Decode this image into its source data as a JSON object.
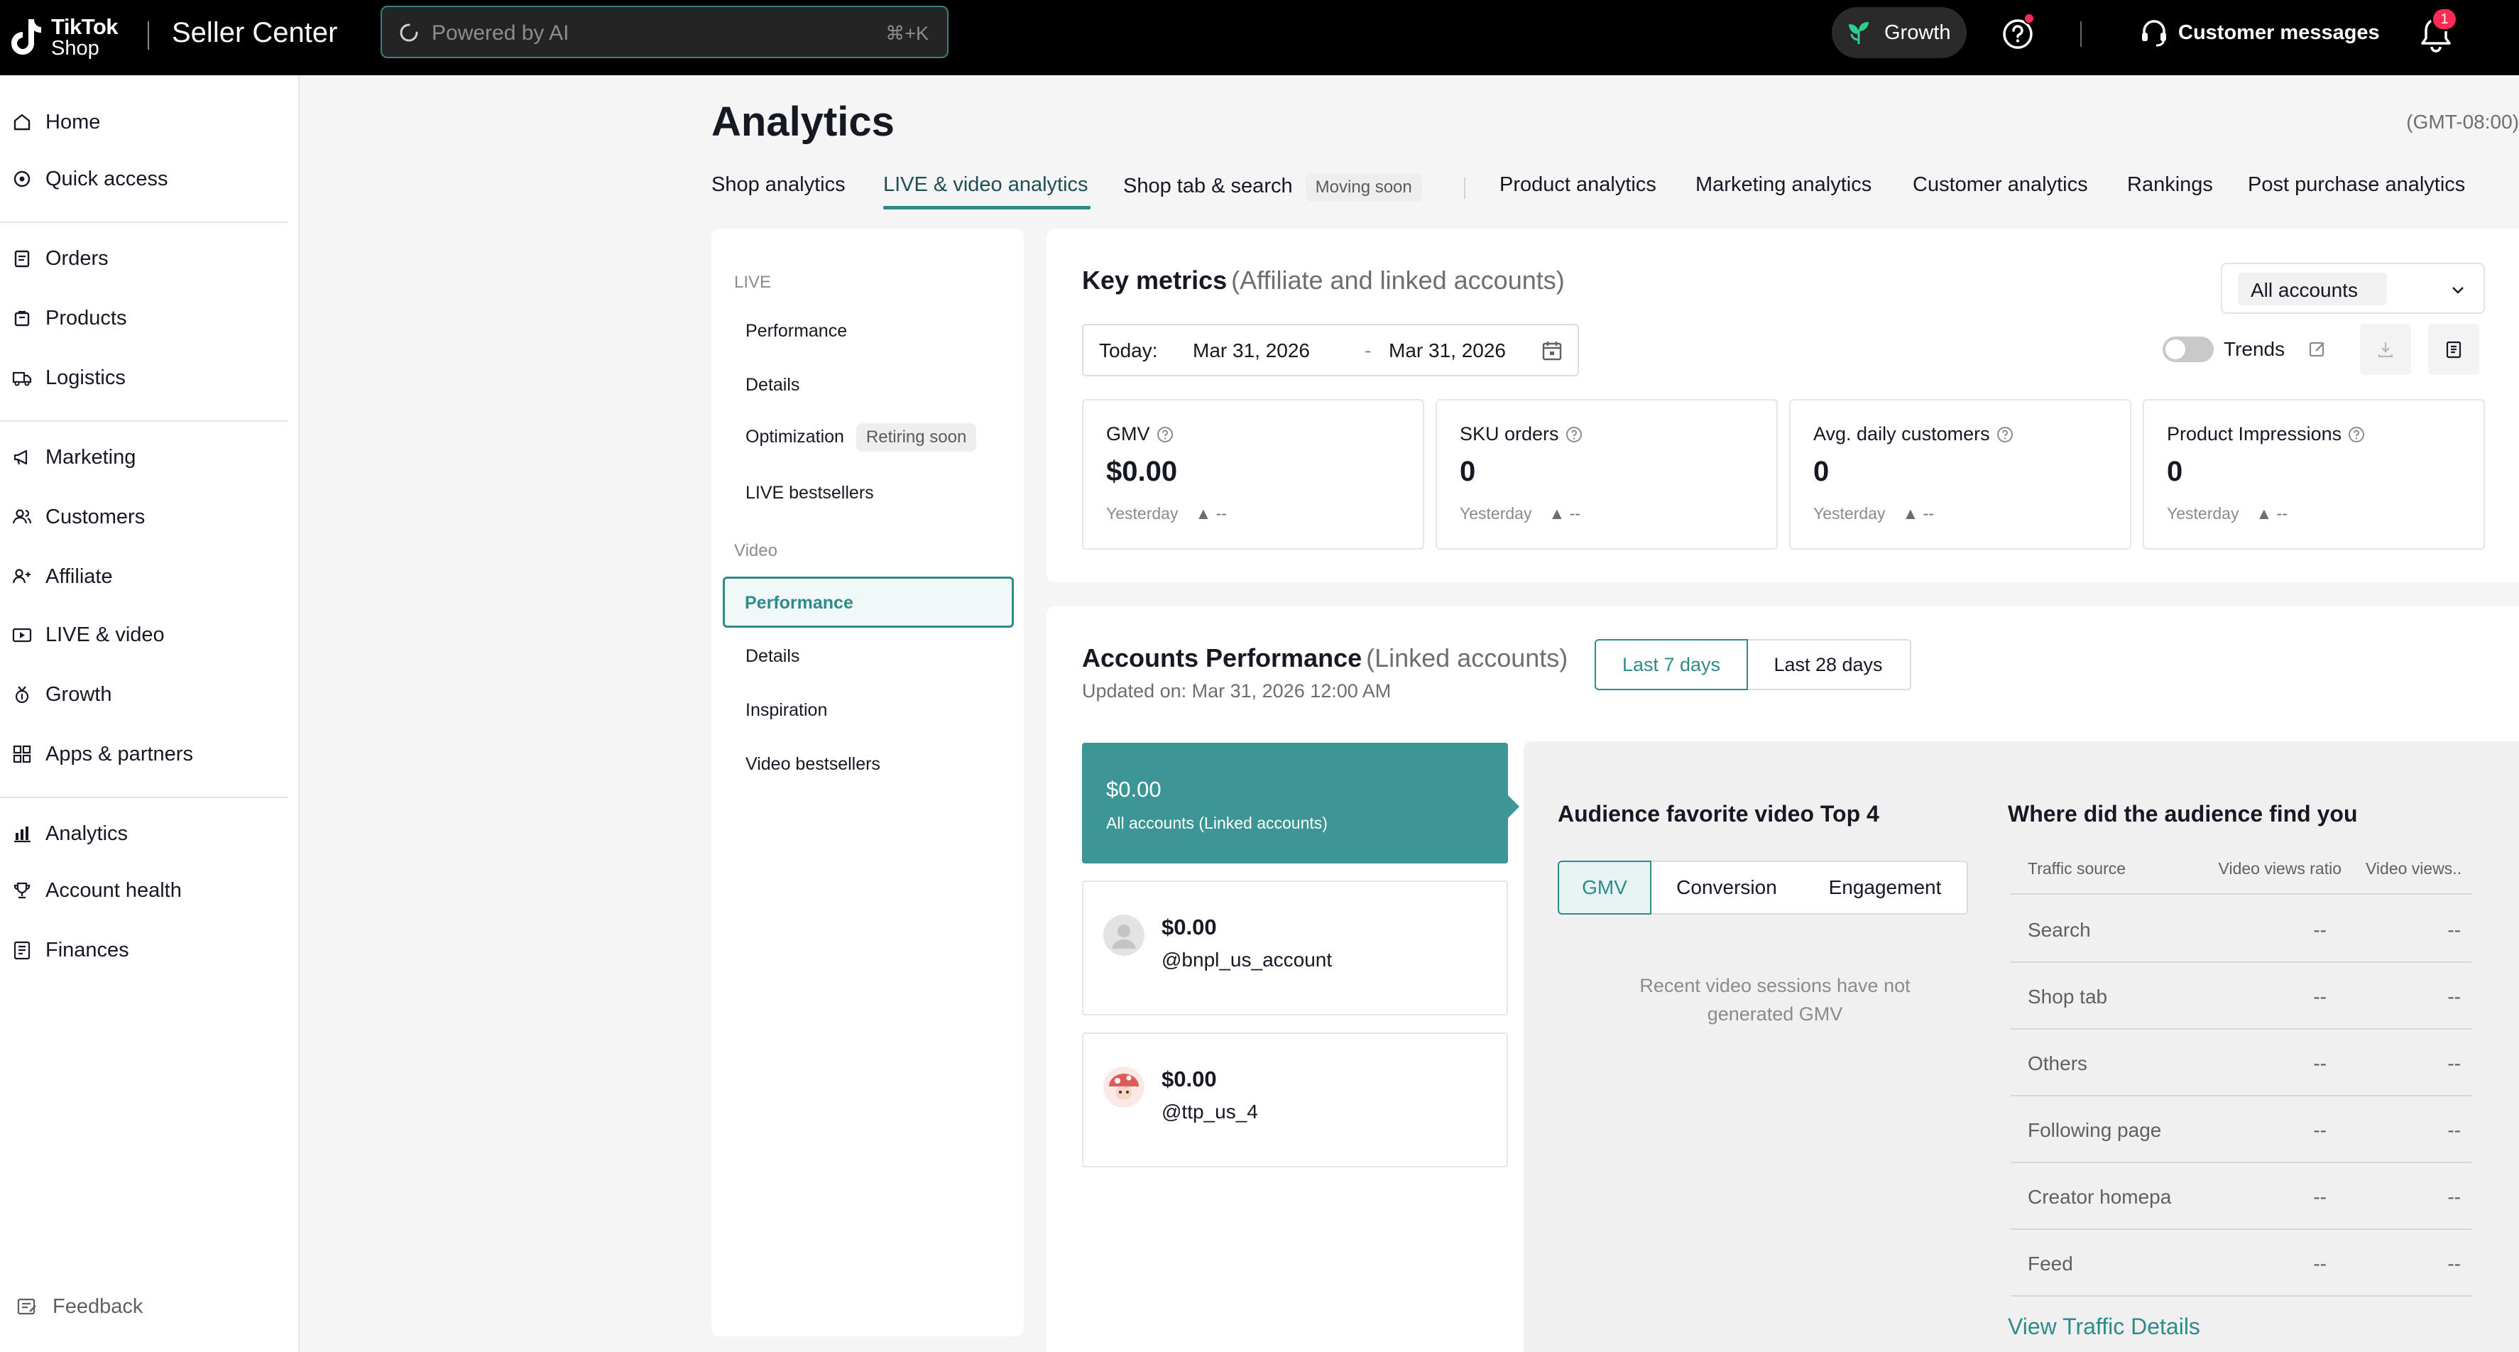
{
  "topbar": {
    "logo_line1": "TikTok",
    "logo_line2": "Shop",
    "product": "Seller Center",
    "search_placeholder": "Powered by AI",
    "search_shortcut": "⌘+K",
    "growth_label": "Growth",
    "customer_messages": "Customer messages",
    "notification_count": "1"
  },
  "sidebar": {
    "items": [
      {
        "label": "Home",
        "icon": "home-icon"
      },
      {
        "label": "Quick access",
        "icon": "quick-access-icon"
      },
      {
        "label": "Orders",
        "icon": "orders-icon"
      },
      {
        "label": "Products",
        "icon": "products-icon"
      },
      {
        "label": "Logistics",
        "icon": "truck-icon"
      },
      {
        "label": "Marketing",
        "icon": "megaphone-icon"
      },
      {
        "label": "Customers",
        "icon": "customers-icon"
      },
      {
        "label": "Affiliate",
        "icon": "affiliate-icon"
      },
      {
        "label": "LIVE & video",
        "icon": "video-icon"
      },
      {
        "label": "Growth",
        "icon": "growth-icon"
      },
      {
        "label": "Apps & partners",
        "icon": "apps-icon"
      },
      {
        "label": "Analytics",
        "icon": "analytics-icon"
      },
      {
        "label": "Account health",
        "icon": "trophy-icon"
      },
      {
        "label": "Finances",
        "icon": "finances-icon"
      }
    ],
    "feedback": "Feedback"
  },
  "page": {
    "title": "Analytics",
    "timezone": "(GMT-08:00)",
    "tabs": [
      {
        "label": "Shop analytics"
      },
      {
        "label": "LIVE & video analytics"
      },
      {
        "label": "Shop tab & search",
        "badge": "Moving soon"
      },
      {
        "label": "Product analytics"
      },
      {
        "label": "Marketing analytics"
      },
      {
        "label": "Customer analytics"
      },
      {
        "label": "Rankings"
      },
      {
        "label": "Post purchase analytics"
      }
    ],
    "active_tab": "LIVE & video analytics"
  },
  "subnav": {
    "live_group": "LIVE",
    "live_items": [
      "Performance",
      "Details",
      "Optimization",
      "LIVE bestsellers"
    ],
    "optimization_badge": "Retiring soon",
    "video_group": "Video",
    "video_items": [
      "Performance",
      "Details",
      "Inspiration",
      "Video bestsellers"
    ],
    "active_item": "Performance"
  },
  "key_metrics": {
    "title": "Key metrics",
    "subtitle": "(Affiliate and linked accounts)",
    "account_select": "All accounts",
    "date_label": "Today:",
    "date_start": "Mar 31, 2026",
    "date_sep": "-",
    "date_end": "Mar 31, 2026",
    "trends_label": "Trends",
    "trends_on": false,
    "metrics": [
      {
        "label": "GMV",
        "value": "$0.00",
        "compare": "Yesterday",
        "delta": "--"
      },
      {
        "label": "SKU orders",
        "value": "0",
        "compare": "Yesterday",
        "delta": "--"
      },
      {
        "label": "Avg. daily customers",
        "value": "0",
        "compare": "Yesterday",
        "delta": "--"
      },
      {
        "label": "Product Impressions",
        "value": "0",
        "compare": "Yesterday",
        "delta": "--"
      }
    ]
  },
  "accounts_performance": {
    "title": "Accounts Performance",
    "subtitle": "(Linked accounts)",
    "updated": "Updated on: Mar 31, 2026 12:00 AM",
    "periods": [
      "Last 7 days",
      "Last 28 days"
    ],
    "active_period": "Last 7 days",
    "all_accounts": {
      "value": "$0.00",
      "label": "All accounts (Linked accounts)"
    },
    "accounts": [
      {
        "value": "$0.00",
        "handle": "@bnpl_us_account"
      },
      {
        "value": "$0.00",
        "handle": "@ttp_us_4"
      }
    ],
    "video_panel": {
      "title": "Audience favorite video Top 4",
      "segments": [
        "GMV",
        "Conversion",
        "Engagement"
      ],
      "active_segment": "GMV",
      "empty_message": "Recent video sessions have not generated GMV"
    },
    "traffic": {
      "title": "Where did the audience find you",
      "columns": [
        "Traffic source",
        "Video views ratio",
        "Video views.."
      ],
      "rows": [
        {
          "source": "Search",
          "ratio": "--",
          "views": "--"
        },
        {
          "source": "Shop tab",
          "ratio": "--",
          "views": "--"
        },
        {
          "source": "Others",
          "ratio": "--",
          "views": "--"
        },
        {
          "source": "Following page",
          "ratio": "--",
          "views": "--"
        },
        {
          "source": "Creator homepa",
          "ratio": "--",
          "views": "--"
        },
        {
          "source": "Feed",
          "ratio": "--",
          "views": "--"
        }
      ],
      "link": "View Traffic Details"
    }
  },
  "colors": {
    "accent": "#2f8a8b",
    "accent_fill": "#3d9695",
    "topbar": "#000000",
    "badge_red": "#fe2c55"
  }
}
